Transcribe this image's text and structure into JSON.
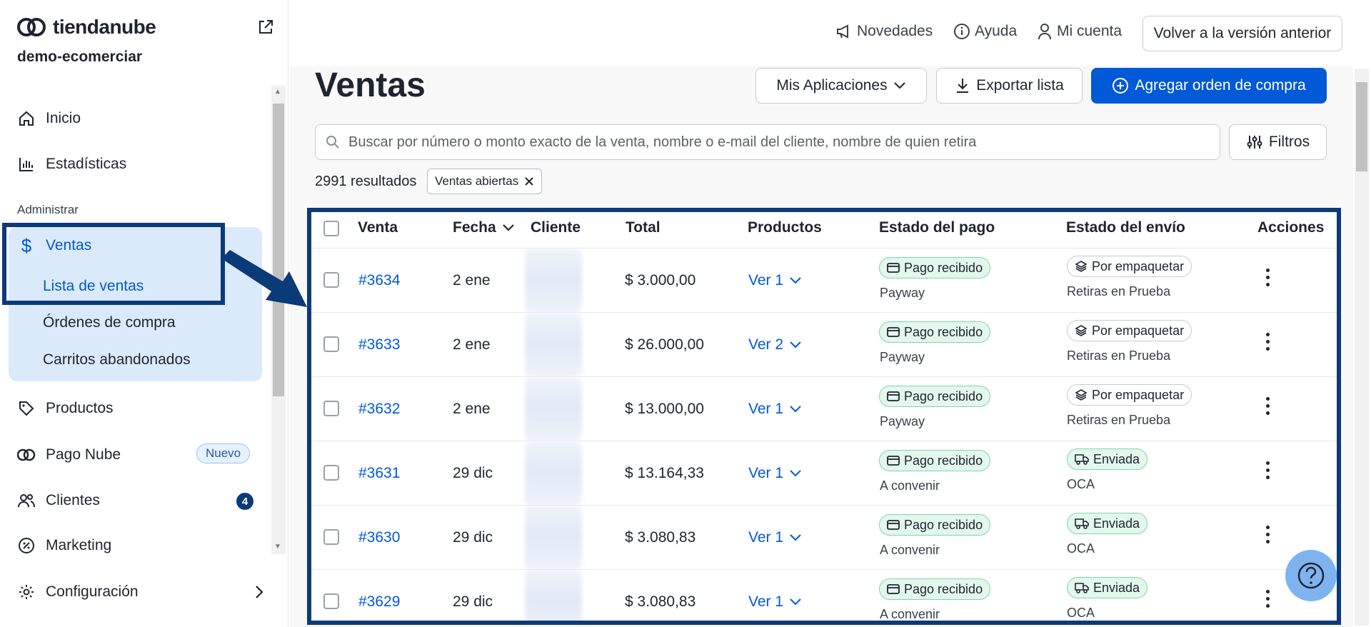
{
  "brand": {
    "name": "tiendanube",
    "store": "demo-ecomerciar"
  },
  "sidebar": {
    "items": [
      {
        "label": "Inicio",
        "icon": "home-icon"
      },
      {
        "label": "Estadísticas",
        "icon": "chart-icon"
      }
    ],
    "section_label": "Administrar",
    "ventas": {
      "label": "Ventas",
      "sub": [
        "Lista de ventas",
        "Órdenes de compra",
        "Carritos abandonados"
      ]
    },
    "items2": [
      {
        "label": "Productos",
        "icon": "tag-icon"
      },
      {
        "label": "Pago Nube",
        "icon": "pagonube-icon",
        "badge": "Nuevo"
      },
      {
        "label": "Clientes",
        "icon": "users-icon",
        "count": "4"
      },
      {
        "label": "Marketing",
        "icon": "percent-icon"
      },
      {
        "label": "Configuración",
        "icon": "gear-icon"
      }
    ]
  },
  "topbar": {
    "novedades": "Novedades",
    "ayuda": "Ayuda",
    "cuenta": "Mi cuenta",
    "old_version": "Volver a la versión anterior"
  },
  "page": {
    "title": "Ventas",
    "apps_btn": "Mis Aplicaciones",
    "export_btn": "Exportar lista",
    "add_btn": "Agregar orden de compra",
    "search_placeholder": "Buscar por número o monto exacto de la venta, nombre o e-mail del cliente, nombre de quien retira",
    "filters_btn": "Filtros",
    "results": "2991 resultados",
    "chip": "Ventas abiertas"
  },
  "table": {
    "headers": [
      "Venta",
      "Fecha",
      "Cliente",
      "Total",
      "Productos",
      "Estado del pago",
      "Estado del envío",
      "Acciones"
    ],
    "rows": [
      {
        "id": "#3634",
        "date": "2 ene",
        "total": "$ 3.000,00",
        "products": "Ver 1",
        "pay": "Pago recibido",
        "pay_method": "Payway",
        "ship": "Por empaquetar",
        "ship_kind": "pack",
        "ship_method": "Retiras en Prueba"
      },
      {
        "id": "#3633",
        "date": "2 ene",
        "total": "$ 26.000,00",
        "products": "Ver 2",
        "pay": "Pago recibido",
        "pay_method": "Payway",
        "ship": "Por empaquetar",
        "ship_kind": "pack",
        "ship_method": "Retiras en Prueba"
      },
      {
        "id": "#3632",
        "date": "2 ene",
        "total": "$ 13.000,00",
        "products": "Ver 1",
        "pay": "Pago recibido",
        "pay_method": "Payway",
        "ship": "Por empaquetar",
        "ship_kind": "pack",
        "ship_method": "Retiras en Prueba"
      },
      {
        "id": "#3631",
        "date": "29 dic",
        "total": "$ 13.164,33",
        "products": "Ver 1",
        "pay": "Pago recibido",
        "pay_method": "A convenir",
        "ship": "Enviada",
        "ship_kind": "sent",
        "ship_method": "OCA"
      },
      {
        "id": "#3630",
        "date": "29 dic",
        "total": "$ 3.080,83",
        "products": "Ver 1",
        "pay": "Pago recibido",
        "pay_method": "A convenir",
        "ship": "Enviada",
        "ship_kind": "sent",
        "ship_method": "OCA"
      },
      {
        "id": "#3629",
        "date": "29 dic",
        "total": "$ 3.080,83",
        "products": "Ver 1",
        "pay": "Pago recibido",
        "pay_method": "A convenir",
        "ship": "Enviada",
        "ship_kind": "sent",
        "ship_method": "OCA"
      }
    ]
  },
  "colors": {
    "accent": "#0059d6",
    "highlight": "#0b3a78",
    "sidebar_active_bg": "#dbeafb",
    "paid_bg": "#e3f7ec"
  }
}
